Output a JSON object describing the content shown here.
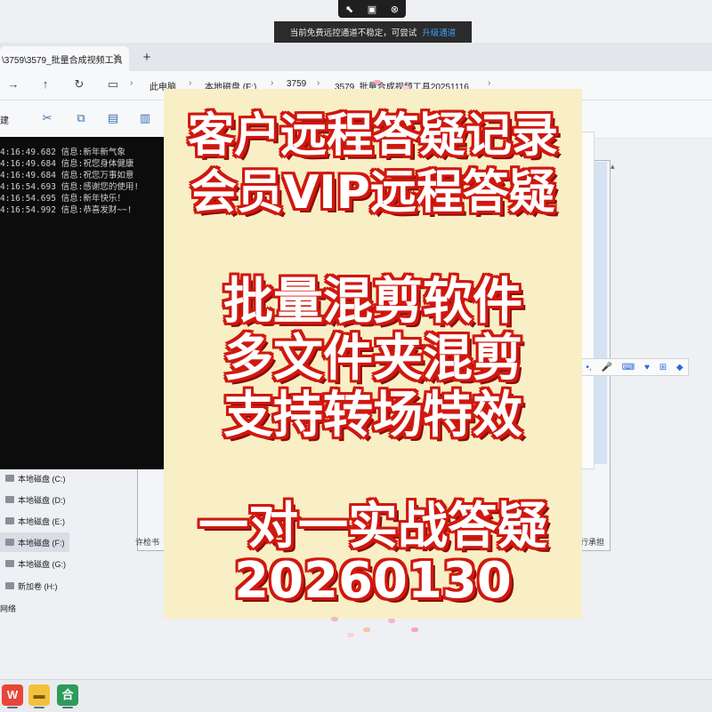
{
  "remote": {
    "notice_text": "当前免费远控通道不稳定，可尝试",
    "notice_link": "升级通道"
  },
  "explorer": {
    "tab_title": "\\3759\\3579_批量合成视频工具",
    "breadcrumbs": [
      "此电脑",
      "本地磁盘 (F:)",
      "3759",
      "3579_批量合成视频工具20251116"
    ],
    "ribbon_new_label": "建",
    "sidebar_drives": [
      {
        "label": "本地磁盘 (C:)",
        "selected": false
      },
      {
        "label": "本地磁盘 (D:)",
        "selected": false
      },
      {
        "label": "本地磁盘 (E:)",
        "selected": false
      },
      {
        "label": "本地磁盘 (F:)",
        "selected": true
      },
      {
        "label": "本地磁盘 (G:)",
        "selected": false
      },
      {
        "label": "新加卷 (H:)",
        "selected": false
      },
      {
        "label": "网络",
        "selected": false
      }
    ]
  },
  "console": {
    "lines": [
      "4:16:49.682 信息:新年新气象",
      "4:16:49.684 信息:祝您身体健康",
      "4:16:49.684 信息:祝您万事如意",
      "4:16:54.693 信息:感谢您的使用!",
      "4:16:54.695 信息:新年快乐！",
      "4:16:54.992 信息:恭喜发财~~!"
    ]
  },
  "background_dialog": {
    "status_left": "许检书",
    "status_right": "行承担"
  },
  "poster": {
    "line1": "客户远程答疑记录",
    "line2": "会员VIP远程答疑",
    "line3": "批量混剪软件",
    "line4": "多文件夹混剪",
    "line5": "支持转场特效",
    "line6": "一对一实战答疑",
    "line7": "20260130"
  },
  "taskbar": {
    "app3_label": "合"
  },
  "colors": {
    "poster_bg": "#f8efc6",
    "poster_text_outline": "#d0180e",
    "console_bg": "#0c0c0c",
    "notice_link": "#3c9cff"
  }
}
